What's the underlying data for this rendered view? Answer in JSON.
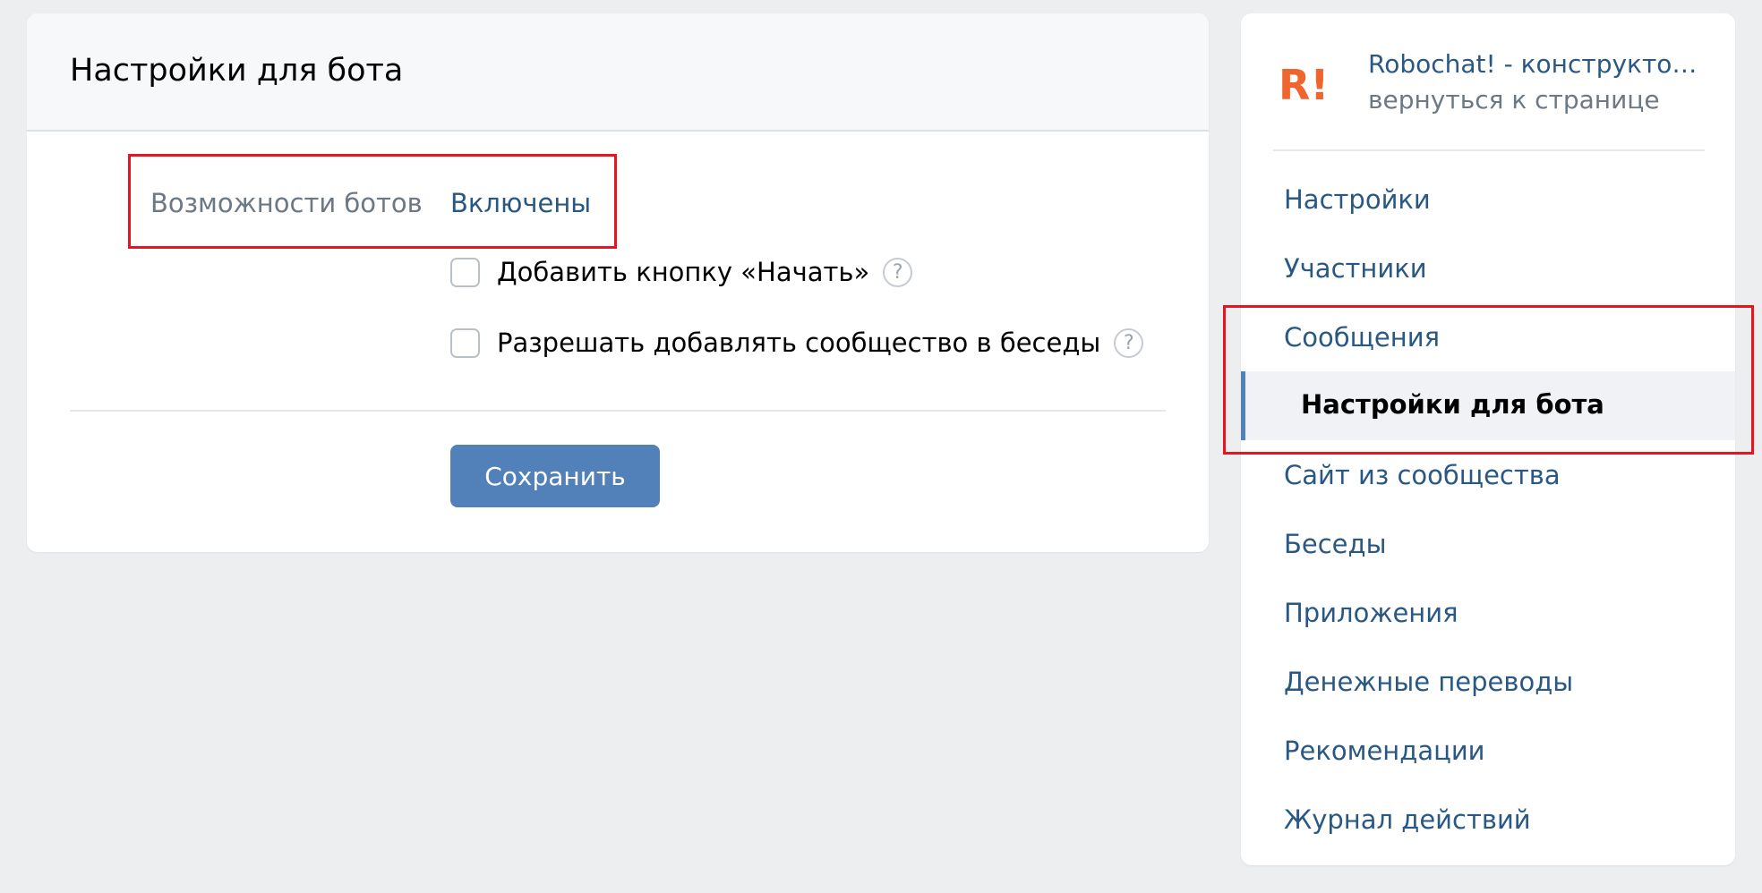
{
  "main": {
    "title": "Настройки для бота",
    "bot_capabilities": {
      "label": "Возможности ботов",
      "value": "Включены"
    },
    "checkboxes": [
      {
        "label": "Добавить кнопку «Начать»",
        "checked": false,
        "help_icon": "question-mark"
      },
      {
        "label": "Разрешать добавлять сообщество в беседы",
        "checked": false,
        "help_icon": "question-mark"
      }
    ],
    "save_label": "Сохранить"
  },
  "sidebar": {
    "logo_text": "R!",
    "club_name": "Robochat! - конструктор чат-ботов",
    "back_link": "вернуться к странице",
    "items": [
      {
        "label": "Настройки"
      },
      {
        "label": "Участники"
      },
      {
        "label": "Сообщения"
      },
      {
        "label": "Настройки для бота",
        "active": true
      },
      {
        "label": "Сайт из сообщества"
      },
      {
        "label": "Беседы"
      },
      {
        "label": "Приложения"
      },
      {
        "label": "Денежные переводы"
      },
      {
        "label": "Рекомендации"
      },
      {
        "label": "Журнал действий"
      }
    ]
  },
  "colors": {
    "accent": "#2a5885",
    "button": "#5181b8",
    "annotation": "#e8141f",
    "logo": "#f0642e",
    "background": "#edeef0"
  }
}
